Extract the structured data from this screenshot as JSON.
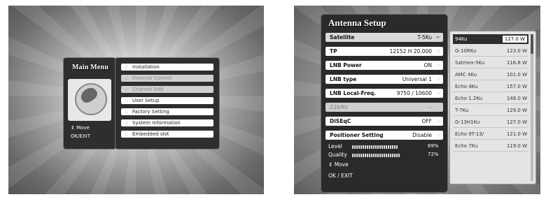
{
  "left_menu": {
    "title": "Main Menu",
    "move_hint": "Move",
    "ok_exit_hint": "OK/EXIT",
    "items": [
      {
        "label": "Installation",
        "enabled": true
      },
      {
        "label": "Parental Control",
        "enabled": false
      },
      {
        "label": "Channel Edit",
        "enabled": false
      },
      {
        "label": "User Setup",
        "enabled": true
      },
      {
        "label": "Factory Setting",
        "enabled": true
      },
      {
        "label": "System Information",
        "enabled": true
      },
      {
        "label": "Embedded slot",
        "enabled": true
      }
    ]
  },
  "antenna_setup": {
    "title": "Antenna Setup",
    "rows": [
      {
        "label": "Satellite",
        "value": "T-5Ku"
      },
      {
        "label": "TP",
        "value": "12152 H 20.000"
      },
      {
        "label": "LNB Power",
        "value": "ON"
      },
      {
        "label": "LNB type",
        "value": "Universal 1"
      },
      {
        "label": "LNB Local-Freq.",
        "value": "9750 / 10600"
      },
      {
        "label": "22kHz",
        "value": "---"
      },
      {
        "label": "DiSEqC",
        "value": "OFF"
      },
      {
        "label": "Positioner Setting",
        "value": "Disable"
      }
    ],
    "level_label": "Level",
    "level_pct": "69%",
    "level_value": 0.69,
    "quality_label": "Quality",
    "quality_pct": "72%",
    "quality_value": 0.72,
    "move_hint": "Move",
    "ok_exit_hint": "OK / EXIT"
  },
  "satellite_list": [
    {
      "name": "94Ku",
      "deg": "127.0 W"
    },
    {
      "name": "G-10RKu",
      "deg": "123.0 W"
    },
    {
      "name": "Satmex-5Ku",
      "deg": "116.8 W"
    },
    {
      "name": "AMC 4Ku",
      "deg": "101.0 W"
    },
    {
      "name": "Echo 4Ku",
      "deg": "157.0 W"
    },
    {
      "name": "Echo 1.2Ku",
      "deg": "148.0 W"
    },
    {
      "name": "T-7Ku",
      "deg": "129.0 W"
    },
    {
      "name": "G-13H1Ku",
      "deg": "127.0 W"
    },
    {
      "name": "Echo 9T-13/",
      "deg": "121.0 W"
    },
    {
      "name": "Echo 7Ku",
      "deg": "119.0 W"
    }
  ]
}
